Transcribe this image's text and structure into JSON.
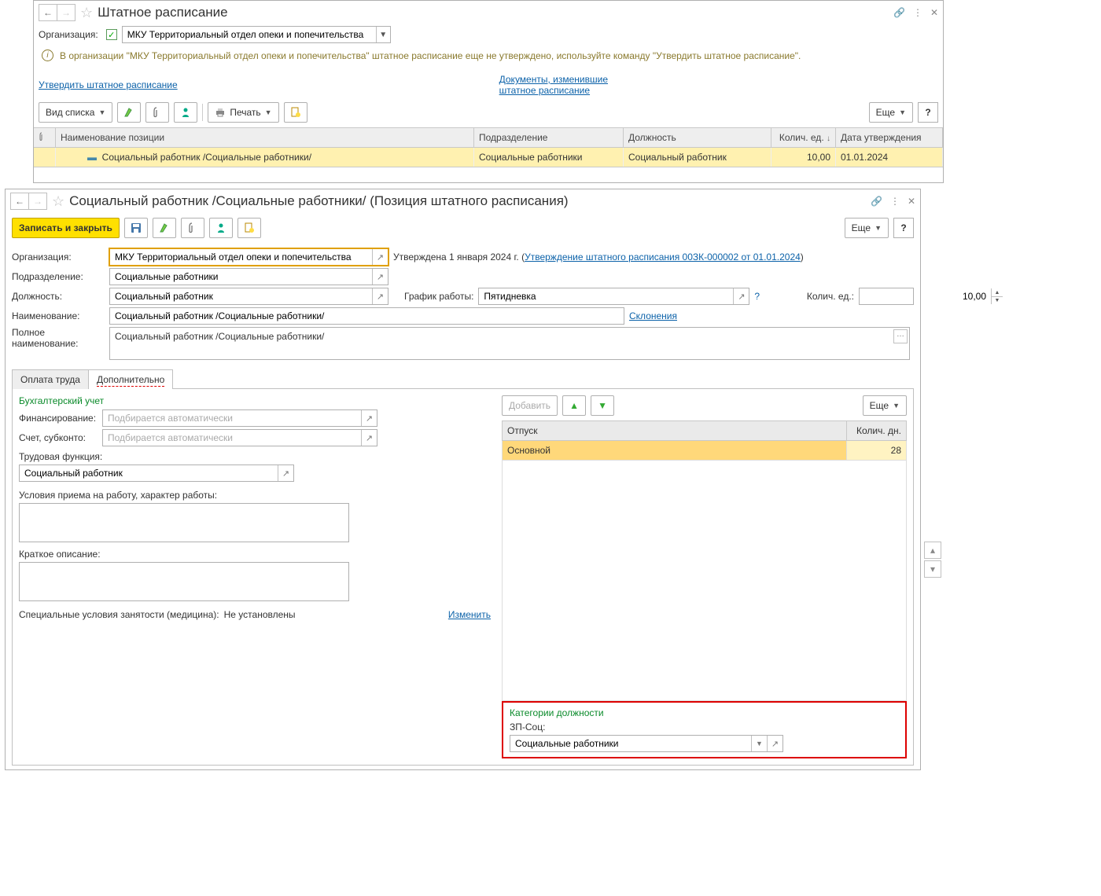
{
  "win1": {
    "title": "Штатное расписание",
    "org_label": "Организация:",
    "org_value": "МКУ Территориальный отдел опеки и попечительства",
    "info": "В организации \"МКУ Территориальный отдел опеки и попечительства\" штатное расписание еще не утверждено, используйте команду \"Утвердить штатное расписание\".",
    "approve_link": "Утвердить штатное расписание",
    "docs_link1": "Документы, изменившие",
    "docs_link2": "штатное расписание",
    "view_btn": "Вид списка",
    "print_btn": "Печать",
    "more_btn": "Еще",
    "headers": {
      "name": "Наименование позиции",
      "dep": "Подразделение",
      "pos": "Должность",
      "qty": "Колич. ед.",
      "date": "Дата утверждения"
    },
    "row": {
      "name": "Социальный работник /Социальные работники/",
      "dep": "Социальные работники",
      "pos": "Социальный работник",
      "qty": "10,00",
      "date": "01.01.2024"
    }
  },
  "win2": {
    "title": "Социальный работник /Социальные работники/ (Позиция штатного расписания)",
    "save_close": "Записать и закрыть",
    "more_btn": "Еще",
    "fields": {
      "org_l": "Организация:",
      "org_v": "МКУ Территориальный отдел опеки и попечительства",
      "approved_text": "Утверждена 1 января 2024 г. (",
      "approved_link": "Утверждение штатного расписания 00ЗК-000002 от 01.01.2024",
      "approved_close": ")",
      "dep_l": "Подразделение:",
      "dep_v": "Социальные работники",
      "pos_l": "Должность:",
      "pos_v": "Социальный работник",
      "sched_l": "График работы:",
      "sched_v": "Пятидневка",
      "qty_l": "Колич. ед.:",
      "qty_v": "10,00",
      "name_l": "Наименование:",
      "name_v": "Социальный работник /Социальные работники/",
      "decl_link": "Склонения",
      "full_l": "Полное наименование:",
      "full_v": "Социальный работник /Социальные работники/"
    },
    "tabs": {
      "pay": "Оплата труда",
      "extra": "Дополнительно"
    },
    "extra": {
      "acc_head": "Бухгалтерский учет",
      "fin_l": "Финансирование:",
      "fin_ph": "Подбирается автоматически",
      "acct_l": "Счет, субконто:",
      "acct_ph": "Подбирается автоматически",
      "func_l": "Трудовая функция:",
      "func_v": "Социальный работник",
      "cond_l": "Условия приема на работу, характер работы:",
      "desc_l": "Краткое описание:",
      "med_l": "Специальные условия занятости (медицина):",
      "med_v": "Не установлены",
      "change_link": "Изменить",
      "add_btn": "Добавить",
      "vac_head": "Отпуск",
      "vac_days": "Колич. дн.",
      "vac_row": "Основной",
      "vac_val": "28",
      "cat_head": "Категории должности",
      "cat_l": "ЗП-Соц:",
      "cat_v": "Социальные работники"
    }
  }
}
